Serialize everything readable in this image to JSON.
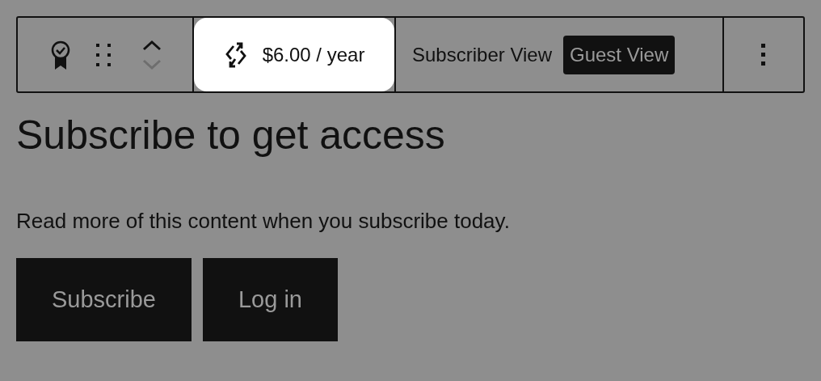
{
  "toolbar": {
    "move_up_disabled": false,
    "move_down_disabled": true,
    "price": "$6.00 / year",
    "price_selected": true,
    "views": [
      {
        "label": "Subscriber View",
        "selected": false
      },
      {
        "label": "Guest View",
        "selected": true
      }
    ]
  },
  "heading": "Subscribe to get access",
  "text": "Read more of this content when you subscribe today.",
  "buttons": [
    "Subscribe",
    "Log in"
  ]
}
